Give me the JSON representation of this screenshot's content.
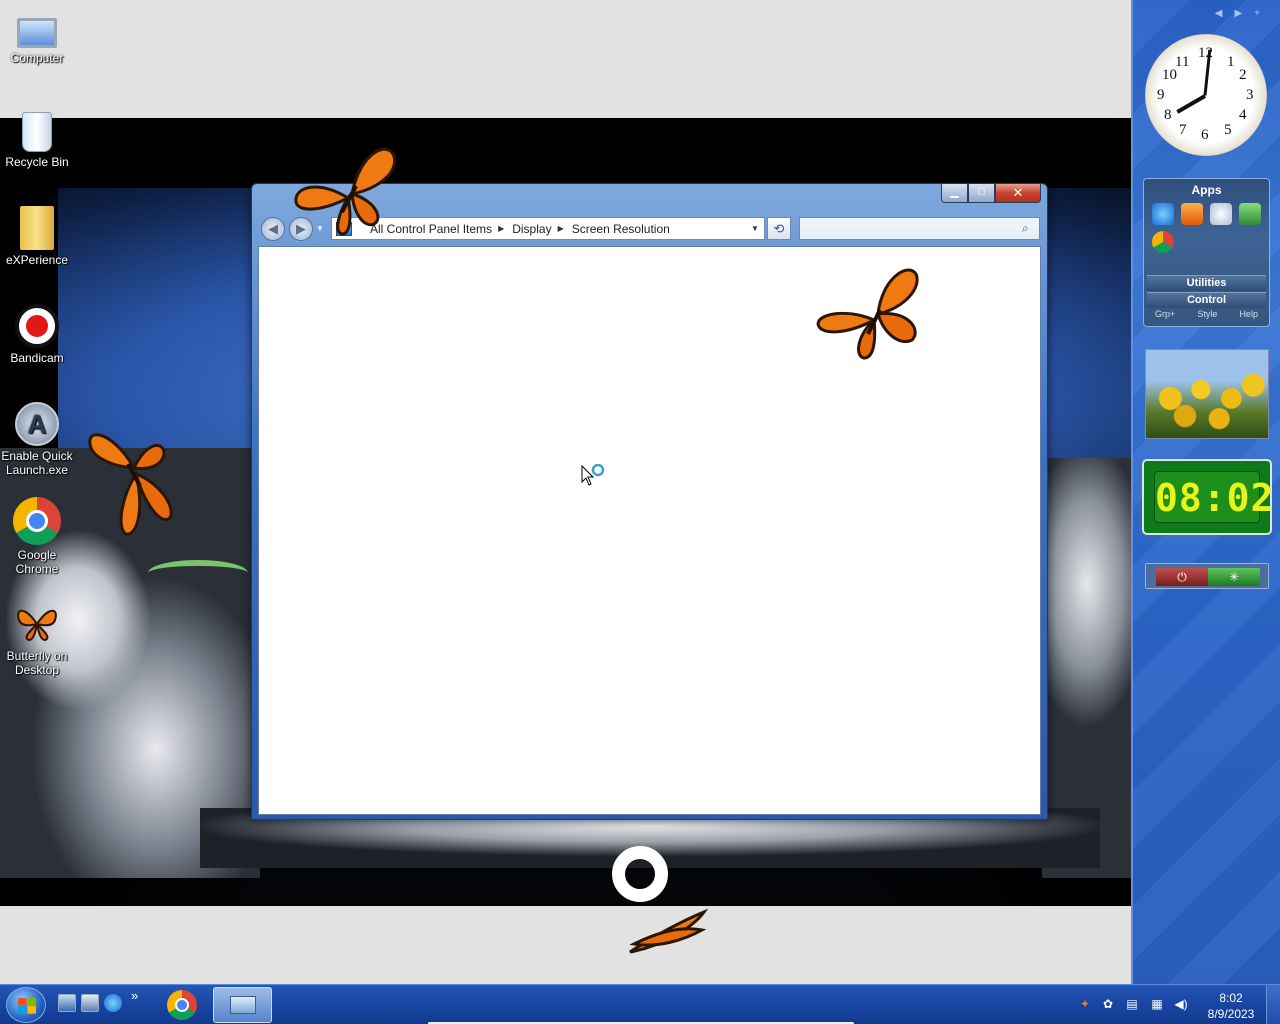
{
  "desktop": {
    "icons": [
      {
        "label": "Computer"
      },
      {
        "label": "Recycle Bin"
      },
      {
        "label": "eXPerience"
      },
      {
        "label": "Bandicam"
      },
      {
        "label": "Enable Quick Launch.exe"
      },
      {
        "label": "Google Chrome"
      },
      {
        "label": "Butterfly on Desktop"
      }
    ]
  },
  "window": {
    "breadcrumb": [
      "All Control Panel Items",
      "Display",
      "Screen Resolution"
    ],
    "search_placeholder": "",
    "buttons": {
      "minimize": "▁",
      "maximize": "□",
      "close": "✕"
    }
  },
  "sidebar": {
    "clock_numbers": [
      "12",
      "1",
      "2",
      "3",
      "4",
      "5",
      "6",
      "7",
      "8",
      "9",
      "10",
      "11"
    ],
    "apps_panel": {
      "title": "Apps",
      "utilities": "Utilities",
      "control": "Control",
      "footer": [
        "Grp+",
        "Style",
        "Help"
      ]
    },
    "digital_clock": "08:02"
  },
  "taskbar": {
    "time": "8:02",
    "date": "8/9/2023",
    "quicklaunch_more": "»"
  }
}
